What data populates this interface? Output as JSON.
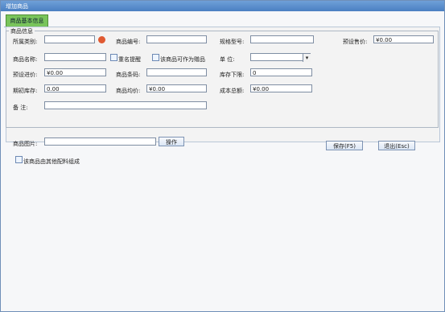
{
  "window": {
    "title": "增加商品"
  },
  "tabs": [
    {
      "label": "商品基本信息"
    }
  ],
  "group_title": "商品信息",
  "fields": {
    "category": {
      "label": "所属类别:",
      "value": ""
    },
    "code": {
      "label": "商品编号:",
      "value": ""
    },
    "spec": {
      "label": "规格型号:",
      "value": ""
    },
    "preset_sale_price": {
      "label": "预设售价:",
      "value": "¥0.00"
    },
    "name": {
      "label": "商品名称:",
      "value": ""
    },
    "duplicate_name_hint": {
      "label": "重名提醒"
    },
    "as_gift": {
      "label": "该商品可作为赠品"
    },
    "unit": {
      "label": "单      位:",
      "value": ""
    },
    "preset_purchase_price": {
      "label": "预设进价:",
      "value": "¥0.00"
    },
    "barcode": {
      "label": "商品条码:",
      "value": ""
    },
    "stock_low": {
      "label": "库存下限:",
      "value": "0"
    },
    "initial_stock": {
      "label": "期初库存:",
      "value": "0.00"
    },
    "avg_price": {
      "label": "商品均价:",
      "value": "¥0.00"
    },
    "total_cost": {
      "label": "成本总额:",
      "value": "¥0.00"
    },
    "remark": {
      "label": "备      注:",
      "value": ""
    }
  },
  "image": {
    "label": "商品图片:",
    "value": "",
    "button": "操作"
  },
  "composite_option": {
    "label": "该商品由其他配料组成"
  },
  "actions": {
    "save": "保存(F5)",
    "exit": "退出(Esc)"
  }
}
